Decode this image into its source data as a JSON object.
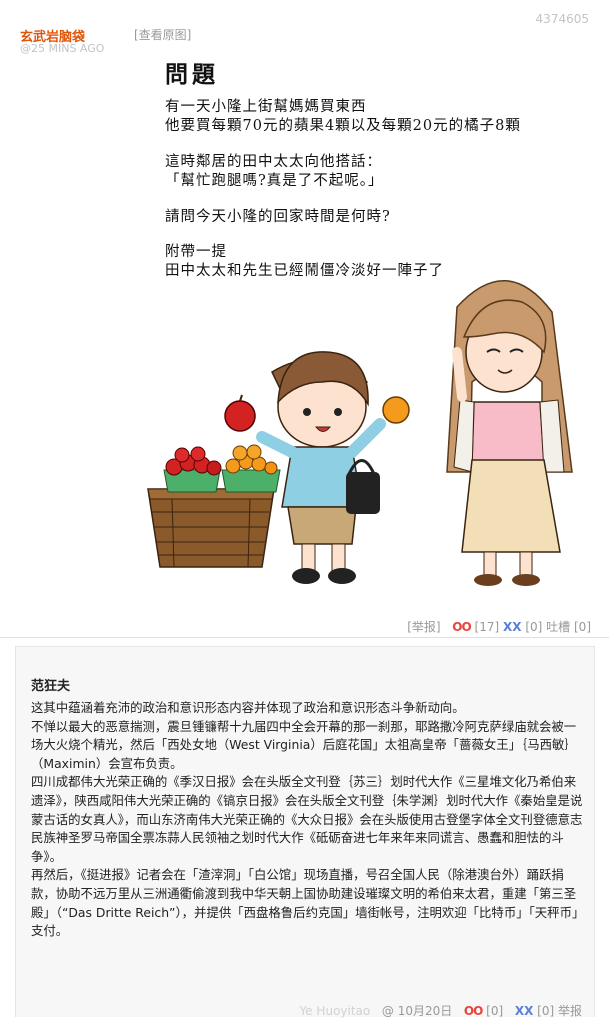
{
  "post": {
    "author": "玄武岩脑袋",
    "time": "@25 MINS AGO",
    "view_original": "[查看原图]",
    "id": "4374605",
    "image": {
      "title": "問題",
      "lines": [
        "有一天小隆上街幫媽媽買東西",
        "他要買每顆70元的蘋果4顆以及每顆20元的橘子8顆",
        "這時鄰居的田中太太向他搭話：",
        "「幫忙跑腿嗎?真是了不起呢。」",
        "請問今天小隆的回家時間是何時?",
        "附帶一提",
        "田中太太和先生已經鬧僵冷淡好一陣子了"
      ]
    },
    "actions": {
      "report": "[举报]",
      "oo_label": "OO",
      "oo_count": "[17]",
      "xx_label": "XX",
      "xx_count": "[0]",
      "tucao_label": "吐槽",
      "tucao_count": "[0]"
    }
  },
  "comment": {
    "author": "范狂夫",
    "paragraphs": [
      "这其中蕴涵着充沛的政治和意识形态内容并体现了政治和意识形态斗争新动向。",
      "不惮以最大的恶意揣测，震旦锺镰帮十九届四中全会开幕的那一刹那，耶路撒冷阿克萨绿庙就会被一场大火烧个精光，然后「西处女地（West Virginia）后庭花国」太祖高皇帝「蔷薇女王」｛马西敏｝（Maximin）会宣布负责。",
      "四川成都伟大光荣正确的《季汉日报》会在头版全文刊登｛苏三｝划时代大作《三星堆文化乃希伯来遗泽》，陕西咸阳伟大光荣正确的《镐京日报》会在头版全文刊登｛朱学渊｝划时代大作《秦始皇是说蒙古话的女真人》，而山东济南伟大光荣正确的《大众日报》会在头版使用古登堡字体全文刊登德意志民族神圣罗马帝国全票冻蒜人民领袖之划时代大作《砥砺奋进七年来年来同谎言、愚蠢和胆怯的斗争》。",
      "再然后，《挺进报》记者会在「渣滓洞」「白公馆」现场直播，号召全国人民（除港澳台外）踊跃捐款，协助不远万里从三洲通衢偷渡到我中华天朝上国协助建设璀璨文明的希伯来太君，重建「第三圣殿」（“Das Dritte Reich”），并提供「西盘格鲁后约克国」墙街帐号，注明欢迎「比特币」「天秤币」支付。"
    ],
    "footer": {
      "obscured": "Ye Huoyitao",
      "date": "@ 10月20日",
      "oo_label": "OO",
      "oo_count": "[0]",
      "xx_label": "XX",
      "xx_count": "[0]",
      "report": "举报"
    }
  },
  "colors": {
    "author": "#e0540a",
    "oo": "#e8443a",
    "xx": "#5b7fd9",
    "comment_bg": "#f7f7f7"
  }
}
